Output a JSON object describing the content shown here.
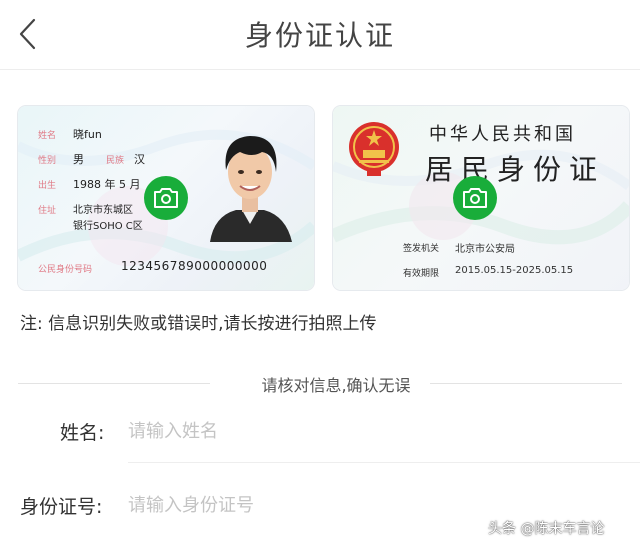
{
  "header": {
    "title": "身份证认证",
    "back_icon": "chevron-left-icon"
  },
  "id_front": {
    "name_label": "姓名",
    "name_value": "晓fun",
    "gender_label": "性别",
    "gender_value": "男",
    "ethnicity_label": "民族",
    "ethnicity_value": "汉",
    "birth_label": "出生",
    "birth_value": "1988 年 5 月",
    "address_label": "住址",
    "address_line1": "北京市东城区",
    "address_line2": "银行SOHO C区",
    "id_number_label": "公民身份号码",
    "id_number_value": "123456789000000000",
    "camera_icon": "camera-icon"
  },
  "id_back": {
    "title_top": "中华人民共和国",
    "title_main": "居民身份证",
    "authority_label": "签发机关",
    "authority_value": "北京市公安局",
    "validity_label": "有效期限",
    "validity_value": "2015.05.15-2025.05.15",
    "emblem_icon": "national-emblem-icon",
    "camera_icon": "camera-icon"
  },
  "note": "注: 信息识别失败或错误时,请长按进行拍照上传",
  "divider_text": "请核对信息,确认无误",
  "form": {
    "name_label": "姓名:",
    "name_placeholder": "请输入姓名",
    "id_label": "身份证号:",
    "id_placeholder": "请输入身份证号"
  },
  "watermark": "头条 @陈末车言论",
  "colors": {
    "accent_green": "#19ad3a",
    "label_pink": "#e07a86",
    "emblem_red": "#d9302c"
  }
}
